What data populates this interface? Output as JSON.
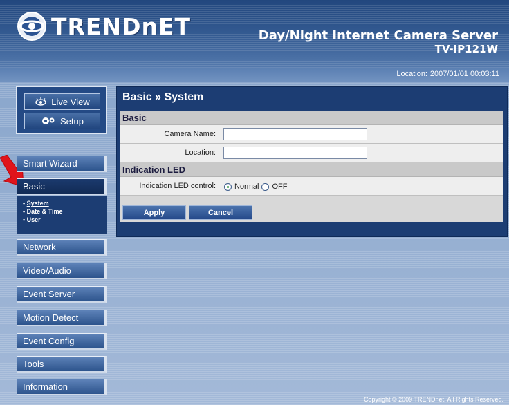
{
  "header": {
    "brand": "TRENDnET",
    "product_title": "Day/Night Internet Camera Server",
    "model": "TV-IP121W",
    "logo_icon": "trendnet-logo-icon"
  },
  "status_bar": {
    "location_label": "Location:",
    "datetime": "2007/01/01 00:03:11"
  },
  "view_controls": {
    "live_view": "Live View",
    "setup": "Setup"
  },
  "sidebar": {
    "items": [
      {
        "label": "Smart Wizard"
      },
      {
        "label": "Basic",
        "active": true
      },
      {
        "label": "Network"
      },
      {
        "label": "Video/Audio"
      },
      {
        "label": "Event Server"
      },
      {
        "label": "Motion Detect"
      },
      {
        "label": "Event Config"
      },
      {
        "label": "Tools"
      },
      {
        "label": "Information"
      }
    ],
    "basic_submenu": [
      {
        "label": "System",
        "current": true
      },
      {
        "label": "Date & Time"
      },
      {
        "label": "User"
      }
    ]
  },
  "main": {
    "title": "Basic » System",
    "sections": {
      "basic": "Basic",
      "indication_led": "Indication LED"
    },
    "fields": {
      "camera_name": {
        "label": "Camera Name:",
        "value": ""
      },
      "location": {
        "label": "Location:",
        "value": ""
      },
      "led_control": {
        "label": "Indication LED control:",
        "options": [
          "Normal",
          "OFF"
        ],
        "selected": "Normal"
      }
    },
    "buttons": {
      "apply": "Apply",
      "cancel": "Cancel"
    }
  },
  "footer": {
    "copyright": "Copyright © 2009 TRENDnet. All Rights Reserved."
  },
  "colors": {
    "header_blue": "#22477e",
    "nav_blue": "#2d548d",
    "panel_navy": "#1c3d73",
    "arrow_red": "#e0141b"
  }
}
